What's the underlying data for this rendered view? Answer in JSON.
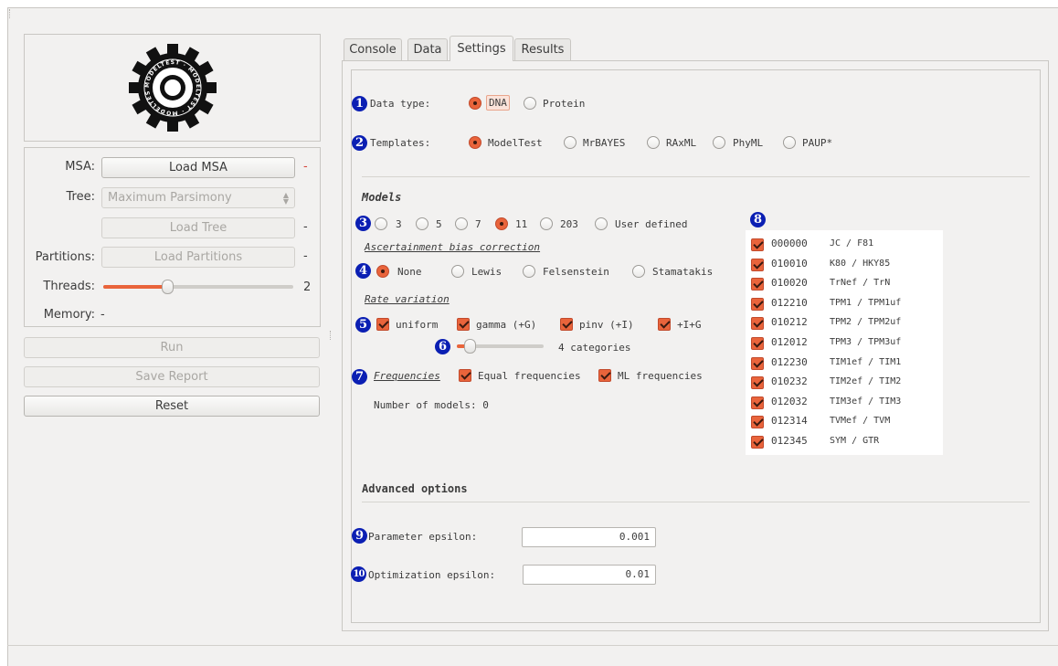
{
  "left": {
    "msa_label": "MSA:",
    "load_msa": "Load MSA",
    "msa_status": "-",
    "tree_label": "Tree:",
    "tree_value": "Maximum Parsimony",
    "load_tree": "Load Tree",
    "tree_status": "-",
    "partitions_label": "Partitions:",
    "load_partitions": "Load Partitions",
    "partitions_status": "-",
    "threads_label": "Threads:",
    "threads_value": "2",
    "threads_level": 0.33,
    "memory_label": "Memory:",
    "memory_value": "-",
    "run": "Run",
    "save_report": "Save Report",
    "reset": "Reset",
    "logo_text": "MODELTEST"
  },
  "tabs": [
    "Console",
    "Data",
    "Settings",
    "Results"
  ],
  "active_tab": "Settings",
  "settings": {
    "data_type_label": "Data type:",
    "data_types": [
      "DNA",
      "Protein"
    ],
    "data_type_selected": "DNA",
    "templates_label": "Templates:",
    "templates": [
      "ModelTest",
      "MrBAYES",
      "RAxML",
      "PhyML",
      "PAUP*"
    ],
    "template_selected": "ModelTest",
    "models_title": "Models",
    "model_counts": [
      "3",
      "5",
      "7",
      "11",
      "203",
      "User defined"
    ],
    "model_count_selected": "11",
    "asc_title": "Ascertainment bias correction",
    "asc_options": [
      "None",
      "Lewis",
      "Felsenstein",
      "Stamatakis"
    ],
    "asc_selected": "None",
    "rate_title": "Rate variation",
    "rate_options": [
      "uniform",
      "gamma (+G)",
      "pinv (+I)",
      "+I+G"
    ],
    "categories_text": "4 categories",
    "categories_level": 0.1,
    "freq_title": "Frequencies",
    "freq_options": [
      "Equal frequencies",
      "ML frequencies"
    ],
    "num_models_text": "Number of models:  0",
    "models": [
      {
        "code": "000000",
        "name": "JC / F81"
      },
      {
        "code": "010010",
        "name": "K80 / HKY85"
      },
      {
        "code": "010020",
        "name": "TrNef / TrN"
      },
      {
        "code": "012210",
        "name": "TPM1 / TPM1uf"
      },
      {
        "code": "010212",
        "name": "TPM2 / TPM2uf"
      },
      {
        "code": "012012",
        "name": "TPM3 / TPM3uf"
      },
      {
        "code": "012230",
        "name": "TIM1ef / TIM1"
      },
      {
        "code": "010232",
        "name": "TIM2ef / TIM2"
      },
      {
        "code": "012032",
        "name": "TIM3ef / TIM3"
      },
      {
        "code": "012314",
        "name": "TVMef / TVM"
      },
      {
        "code": "012345",
        "name": "SYM / GTR"
      }
    ],
    "advanced_title": "Advanced options",
    "param_eps_label": "Parameter epsilon:",
    "param_eps_value": "0.001",
    "opt_eps_label": "Optimization epsilon:",
    "opt_eps_value": "0.01"
  },
  "annotations": [
    "1",
    "2",
    "3",
    "4",
    "5",
    "6",
    "7",
    "8",
    "9",
    "10"
  ],
  "colors": {
    "accent": "#e9643b",
    "annotation": "#0b1fb3"
  }
}
